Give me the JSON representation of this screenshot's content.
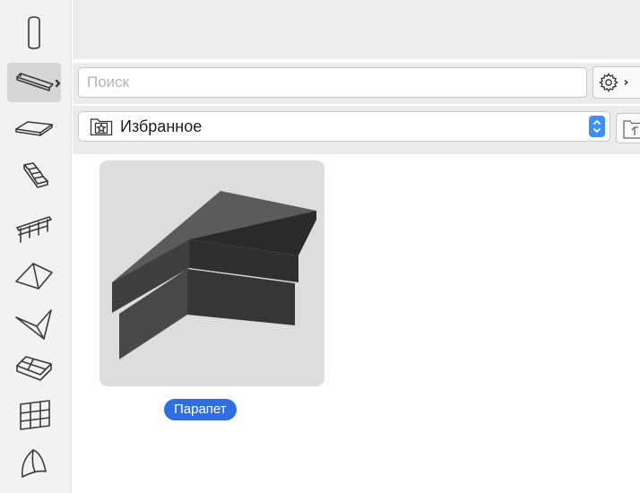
{
  "search": {
    "placeholder": "Поиск",
    "value": ""
  },
  "library": {
    "selected": "Избранное"
  },
  "items": [
    {
      "label": "Парапет"
    }
  ],
  "toolbox": {
    "tools": [
      "column-tool",
      "beam-tool",
      "slab-tool",
      "stair-tool",
      "railing-tool",
      "roof-tool",
      "shell-tool",
      "mesh-tool",
      "curtain-wall-tool",
      "morph-tool"
    ],
    "selected": "beam-tool"
  },
  "colors": {
    "accent": "#2f6fe0",
    "stepper": "#3f8ef1",
    "toolbar_bg": "#ececec",
    "tile_bg": "#dddddd"
  }
}
